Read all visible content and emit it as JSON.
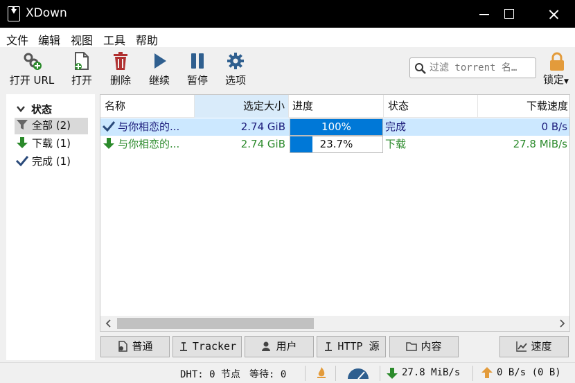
{
  "window": {
    "title": "XDown"
  },
  "menu": [
    "文件",
    "编辑",
    "视图",
    "工具",
    "帮助"
  ],
  "toolbar": {
    "open_url": "打开 URL",
    "open": "打开",
    "delete": "删除",
    "resume": "继续",
    "pause": "暂停",
    "options": "选项",
    "lock": "锁定",
    "filter_placeholder": "过滤 torrent 名…"
  },
  "sidebar": {
    "header": "状态",
    "items": [
      {
        "label": "全部 (2)",
        "icon": "filter-icon",
        "selected": true
      },
      {
        "label": "下载 (1)",
        "icon": "download-arrow-icon",
        "selected": false
      },
      {
        "label": "完成 (1)",
        "icon": "checkmark-icon",
        "selected": false
      }
    ]
  },
  "table": {
    "columns": [
      "名称",
      "选定大小",
      "进度",
      "状态",
      "下载速度"
    ],
    "rows": [
      {
        "name": "与你相恋的...",
        "size": "2.74 GiB",
        "progress_text": "100%",
        "progress": 1.0,
        "status": "完成",
        "speed": "0 B/s",
        "icon": "checkmark-icon",
        "color": "#1a1a7a",
        "selected": true
      },
      {
        "name": "与你相恋的...",
        "size": "2.74 GiB",
        "progress_text": "23.7%",
        "progress": 0.237,
        "status": "下载",
        "speed": "27.8 MiB/s",
        "icon": "download-arrow-icon",
        "color": "#2b8a2b",
        "selected": false
      }
    ]
  },
  "tabs": {
    "general": "普通",
    "tracker": "Tracker",
    "peers": "用户",
    "http": "HTTP 源",
    "content": "内容",
    "speed": "速度"
  },
  "statusbar": {
    "dht": "DHT: 0 节点",
    "waiting": "等待: 0",
    "download": "27.8 MiB/s",
    "upload": "0 B/s (0 B)"
  },
  "colors": {
    "accent": "#0078d7",
    "download_green": "#2b8a2b",
    "complete_blue": "#1a1a7a",
    "selected_row": "#cce8ff"
  }
}
